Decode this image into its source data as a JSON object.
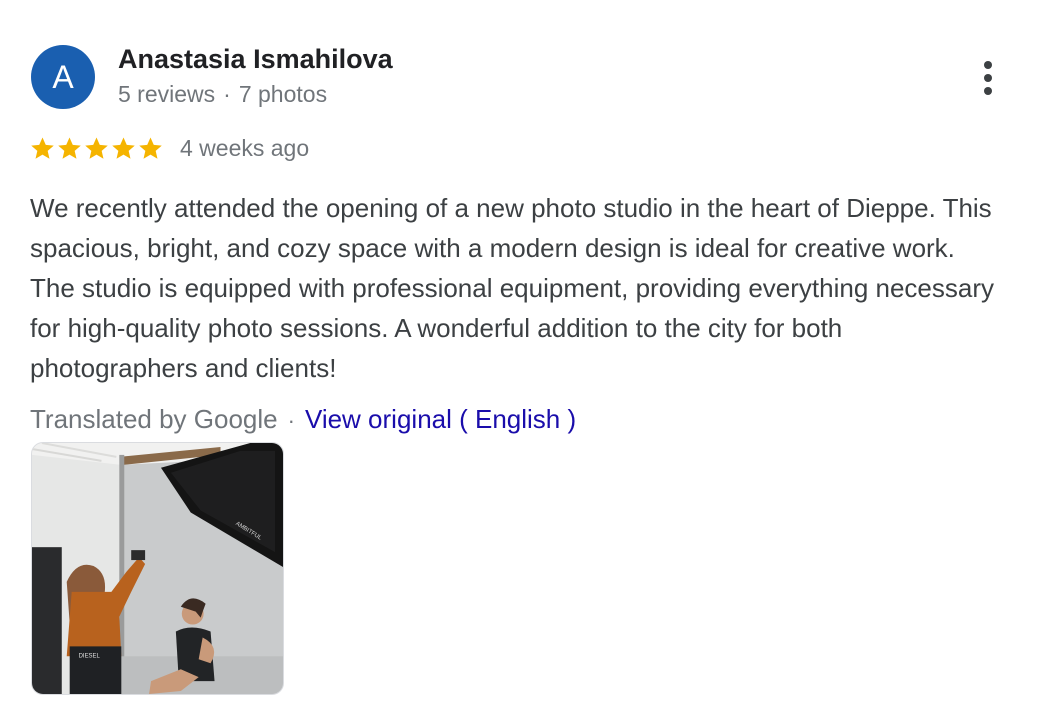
{
  "review": {
    "author": {
      "initial": "A",
      "name": "Anastasia Ismahilova",
      "reviews": "5 reviews",
      "separator": "·",
      "photos": "7 photos",
      "avatar_color": "#1a5fb0"
    },
    "rating": {
      "stars": 5,
      "max": 5,
      "star_color": "#f5b400"
    },
    "date": "4 weeks ago",
    "text": "We recently attended the opening of a new photo studio in the heart of Dieppe. This spacious, bright, and cozy space with a modern design is ideal for creative work. The studio is equipped with professional equipment, providing everything necessary for high-quality photo sessions. A wonderful addition to the city for both photographers and clients!",
    "translation": {
      "label": "Translated by Google",
      "separator": "·",
      "link": "View original ( English )",
      "link_color": "#1a0dab"
    },
    "photo": {
      "softbox_brand": "AMBITFUL",
      "shirt_text": "DIESEL"
    }
  },
  "icons": {
    "more": "more-vert-icon",
    "star": "star-icon"
  }
}
